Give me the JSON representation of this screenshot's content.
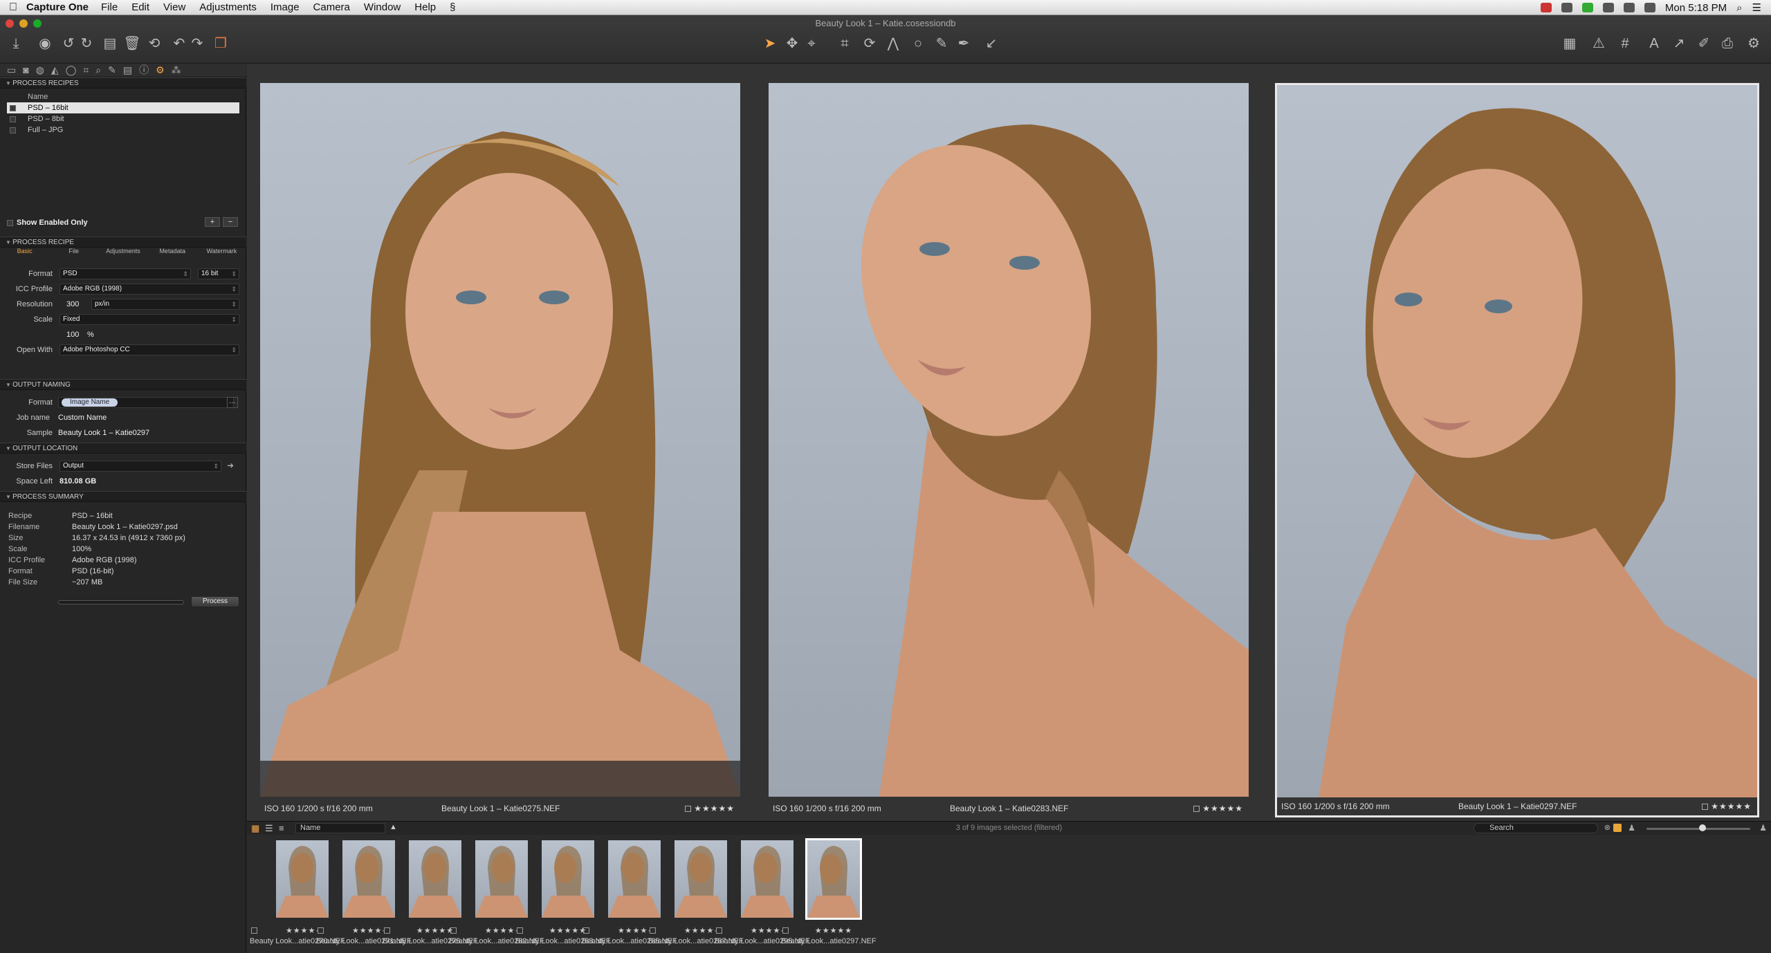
{
  "menubar": {
    "app_name": "Capture One",
    "items": [
      "File",
      "Edit",
      "View",
      "Adjustments",
      "Image",
      "Camera",
      "Window",
      "Help"
    ],
    "clock": "Mon 5:18 PM"
  },
  "window": {
    "title": "Beauty Look 1 – Katie.cosessiondb"
  },
  "process_recipes": {
    "header": "PROCESS RECIPES",
    "column": "Name",
    "items": [
      "PSD – 16bit",
      "PSD – 8bit",
      "Full – JPG"
    ],
    "show_enabled_only": "Show Enabled Only"
  },
  "process_recipe": {
    "header": "PROCESS RECIPE",
    "tabs": [
      "Basic",
      "File",
      "Adjustments",
      "Metadata",
      "Watermark"
    ],
    "format_label": "Format",
    "format_value": "PSD",
    "bit_value": "16 bit",
    "icc_label": "ICC Profile",
    "icc_value": "Adobe RGB (1998)",
    "resolution_label": "Resolution",
    "resolution_value": "300",
    "resolution_unit": "px/in",
    "scale_label": "Scale",
    "scale_value": "Fixed",
    "scale_percent": "100",
    "percent_sign": "%",
    "open_with_label": "Open With",
    "open_with_value": "Adobe Photoshop CC"
  },
  "output_naming": {
    "header": "OUTPUT NAMING",
    "format_label": "Format",
    "format_token": "Image Name",
    "job_label": "Job name",
    "job_value": "Custom Name",
    "sample_label": "Sample",
    "sample_value": "Beauty Look 1 – Katie0297"
  },
  "output_location": {
    "header": "OUTPUT LOCATION",
    "store_label": "Store Files",
    "store_value": "Output",
    "space_label": "Space Left",
    "space_value": "810.08 GB"
  },
  "process_summary": {
    "header": "PROCESS SUMMARY",
    "rows": [
      {
        "k": "Recipe",
        "v": "PSD – 16bit"
      },
      {
        "k": "Filename",
        "v": "Beauty Look 1 – Katie0297.psd"
      },
      {
        "k": "Size",
        "v": "16.37 x 24.53 in (4912 x 7360 px)"
      },
      {
        "k": "Scale",
        "v": "100%"
      },
      {
        "k": "ICC Profile",
        "v": "Adobe RGB (1998)"
      },
      {
        "k": "Format",
        "v": "PSD (16-bit)"
      },
      {
        "k": "File Size",
        "v": "~207 MB"
      }
    ],
    "process_button": "Process"
  },
  "viewer": {
    "photos": [
      {
        "meta": "ISO 160    1/200 s    f/16    200 mm",
        "name": "Beauty Look 1 – Katie0275.NEF",
        "stars": "★★★★★"
      },
      {
        "meta": "ISO 160    1/200 s    f/16    200 mm",
        "name": "Beauty Look 1 – Katie0283.NEF",
        "stars": "★★★★★"
      },
      {
        "meta": "ISO 160    1/200 s    f/16    200 mm",
        "name": "Beauty Look 1 – Katie0297.NEF",
        "stars": "★★★★★"
      }
    ]
  },
  "browser": {
    "sort": "Name",
    "count": "3 of 9 images selected (filtered)",
    "search_placeholder": "Search"
  },
  "filmstrip": {
    "thumbs": [
      {
        "name": "Beauty Look...atie0270.NEF",
        "stars": "★★★★·"
      },
      {
        "name": "Beauty Look...atie0271.NEF",
        "stars": "★★★★·"
      },
      {
        "name": "Beauty Look...atie0275.NEF",
        "stars": "★★★★★"
      },
      {
        "name": "Beauty Look...atie0282.NEF",
        "stars": "★★★★·"
      },
      {
        "name": "Beauty Look...atie0283.NEF",
        "stars": "★★★★★"
      },
      {
        "name": "Beauty Look...atie0285.NEF",
        "stars": "★★★★·"
      },
      {
        "name": "Beauty Look...atie0287.NEF",
        "stars": "★★★★·"
      },
      {
        "name": "Beauty Look...atie0295.NEF",
        "stars": "★★★★·"
      },
      {
        "name": "Beauty Look...atie0297.NEF",
        "stars": "★★★★★"
      }
    ]
  },
  "colors": {
    "accent": "#f7a64a",
    "selection": "#e4e4e4"
  }
}
